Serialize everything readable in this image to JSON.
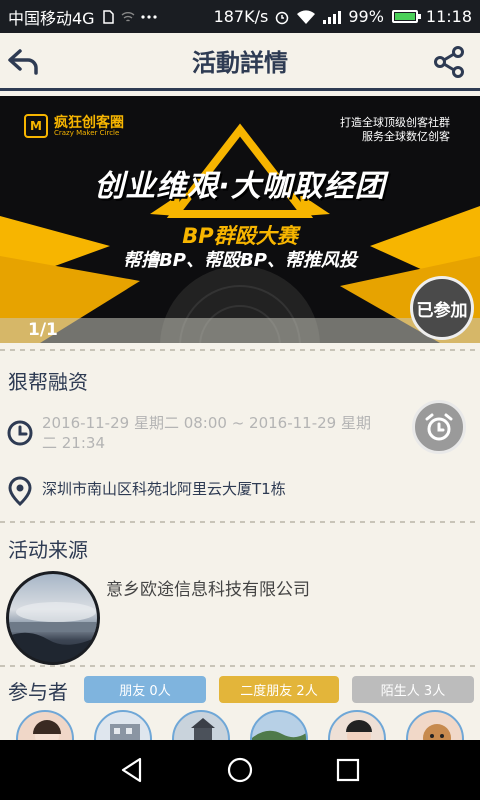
{
  "status_bar": {
    "carrier": "中国移动4G",
    "speed": "187K/s",
    "battery": "99%",
    "time": "11:18",
    "battery_level": 0.99
  },
  "header": {
    "title": "活動詳情",
    "back_icon": "back-arrow-icon",
    "share_icon": "share-icon"
  },
  "banner": {
    "logo_mark": "M",
    "logo_name": "疯狂创客圈",
    "logo_sub": "Crazy Maker Circle",
    "tagline_1": "打造全球顶级创客社群",
    "tagline_2": "服务全球数亿创客",
    "headline": "创业维艰·大咖取经团",
    "subtitle": "BP群殴大赛",
    "slogan": "帮撸BP、帮殴BP、帮推风投",
    "counter": "1/1",
    "joined_label": "已参加"
  },
  "event": {
    "name": "狠帮融资",
    "time": "2016-11-29 星期二 08:00 ~ 2016-11-29 星期二 21:34",
    "address": "深圳市南山区科苑北阿里云大厦T1栋"
  },
  "source": {
    "title": "活动来源",
    "org_name": "意乡欧途信息科技有限公司"
  },
  "participants": {
    "title": "参与者",
    "friends_label": "朋友 0人",
    "second_degree_label": "二度朋友 2人",
    "strangers_label": "陌生人 3人"
  },
  "colors": {
    "primary": "#2e3b53",
    "accent_yellow": "#f7b500",
    "chip_blue": "#7fb4de",
    "chip_gold": "#e3b53a",
    "chip_gray": "#bcbcbc"
  }
}
